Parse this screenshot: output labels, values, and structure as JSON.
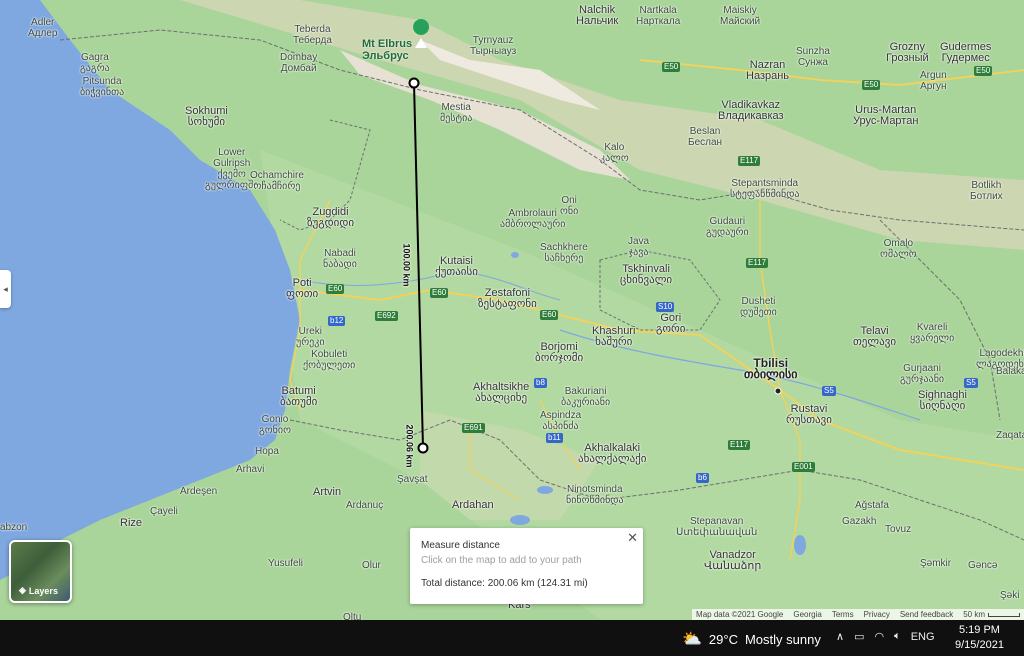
{
  "map": {
    "labels": {
      "adler": "Adler\nАдлер",
      "sochi_area": "Gagra\nგაგრა",
      "pitsunda": "Pitsunda\nბიჭვინთა",
      "sokhumi": "Sokhumi\nსოხუმი",
      "lower_gulripsh": "Lower\nGulripsh\nქვემო\nგულრიფში",
      "ochamchire": "Ochamchire\nოჩამჩირე",
      "teberda": "Teberda\nТеберда",
      "dombay": "Dombay\nДомбай",
      "tyrnyauz": "Tyrnyauz\nТырныауз",
      "mestia": "Mestia\nმესტია",
      "zugdidi": "Zugdidi\nზუგდიდი",
      "nabadi": "Nabadi\nნაბადი",
      "poti": "Poti\nფოთი",
      "ureki": "Ureki\nურეკი",
      "kobuleti": "Kobuleti\nქობულეთი",
      "batumi": "Batumi\nბათუმი",
      "gonio": "Gonio\nგონიო",
      "hopa": "Hopa",
      "ardesen": "Ardeşen",
      "cayeli": "Çayeli",
      "rize": "Rize",
      "trabzon": "abzon",
      "arhavi": "Arhavi",
      "artvin": "Artvin",
      "ardanuc": "Ardanuç",
      "yusufeli": "Yusufeli",
      "savsat": "Şavşat",
      "ardahan": "Ardahan",
      "kars": "Kars",
      "oltu": "Oltu",
      "olur": "Olur",
      "ambrolauri": "Ambrolauri\nამბროლაური",
      "oni": "Oni\nონი",
      "kutaisi": "Kutaisi\nქუთაისი",
      "zestafoni": "Zestafoni\nზესტაფონი",
      "sachkhere": "Sachkhere\nსაჩხერე",
      "java": "Java\nჯავა",
      "tskhinvali": "Tskhinvali\nცხინვალი",
      "gori": "Gori\nგორი",
      "khashuri": "Khashuri\nხაშური",
      "borjomi": "Borjomi\nბორჯომი",
      "akhaltsikhe": "Akhaltsikhe\nახალციხე",
      "bakuriani": "Bakuriani\nბაკურიანი",
      "aspindza": "Aspindza\nასპინძა",
      "akhalkalaki": "Akhalkalaki\nახალქალაქი",
      "ninotsminda": "Ninotsminda\nნინოწმინდა",
      "tbilisi": "Tbilisi\nთბილისი",
      "rustavi": "Rustavi\nრუსთავი",
      "dusheti": "Dusheti\nდუშეთი",
      "gudauri": "Gudauri\nგუდაური",
      "stepantsminda": "Stepantsminda\nსტეფანწმინდა",
      "vladikavkaz": "Vladikavkaz\nВладикавказ",
      "nalchik": "Nalchik\nНальчик",
      "nartkala": "Nartkala\nНарткала",
      "maiskiy": "Maiskiy\nМайский",
      "nazran": "Nazran\nНазрань",
      "grozny": "Grozny\nГрозный",
      "gudermes": "Gudermes\nГудермес",
      "argun": "Argun\nАргун",
      "sunzha": "Sunzha\nСунжа",
      "urus_martan": "Urus-Martan\nУрус-Мартан",
      "botlikh": "Botlikh\nБотлих",
      "telavi": "Telavi\nთელავი",
      "kvareli": "Kvareli\nყვარელი",
      "gurjaani": "Gurjaani\nგურჯაანი",
      "sighnaghi": "Sighnaghi\nსიღნაღი",
      "lagodekhi": "Lagodekhi\nლაგოდეხი",
      "balakan": "Balakan",
      "zaqatala": "Zaqatala",
      "shaki": "Şəki",
      "gazakh": "Gazakh",
      "agstafa": "Ağstafa",
      "tovuz": "Tovuz",
      "shamkir": "Şəmkir",
      "ganja": "Gəncə",
      "vanadzor": "Vanadzor\nՎանաձոր",
      "stepanavan": "Stepanavan\nՍտեփանավան",
      "omalo": "Omalo\nომალო",
      "beslan": "Beslan\nБеслан",
      "kalo": "Kalo\nკალო",
      "mt_elbrus": "Mt Elbrus\nЭльбрус"
    },
    "roads": [
      "E50",
      "E50",
      "E50",
      "E117",
      "E60",
      "E60",
      "E60",
      "E692",
      "E691",
      "E117",
      "E001",
      "E117",
      "S10",
      "S5",
      "S5",
      "b12",
      "b8",
      "b11",
      "b6"
    ],
    "distance_labels": [
      "100.00 km",
      "200.06 km"
    ]
  },
  "measure": {
    "title": "Measure distance",
    "subtitle": "Click on the map to add to your path",
    "total": "Total distance: 200.06 km (124.31 mi)",
    "close": "✕"
  },
  "layers": {
    "label": "Layers"
  },
  "attribution": {
    "map_data": "Map data ©2021 Google",
    "country": "Georgia",
    "terms": "Terms",
    "privacy": "Privacy",
    "feedback": "Send feedback",
    "scale": "50 km"
  },
  "taskbar": {
    "temperature": "29°C",
    "condition": "Mostly sunny",
    "language": "ENG",
    "time": "5:19 PM",
    "date": "9/15/2021"
  },
  "colors": {
    "sea": "#7fa7e0",
    "land": "#a9d49a",
    "mountains": "#d9d2c1",
    "border": "#6e6e6e",
    "measure_line": "#000000"
  }
}
